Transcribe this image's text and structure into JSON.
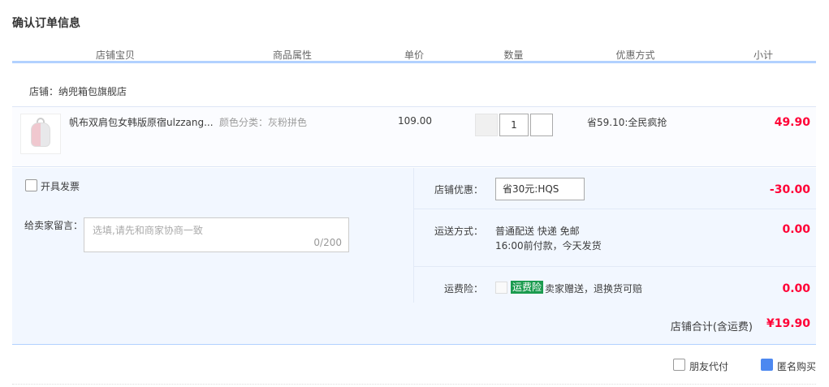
{
  "page": {
    "title": "确认订单信息"
  },
  "columns": [
    "店铺宝贝",
    "商品属性",
    "单价",
    "数量",
    "优惠方式",
    "小计"
  ],
  "shop": {
    "label": "店铺：纳兜箱包旗舰店"
  },
  "item": {
    "thumbnail": "backpack-image",
    "title": "帆布双肩包女韩版原宿ulzzang...",
    "attribute": "颜色分类：灰粉拼色",
    "price": "109.00",
    "quantity": "1",
    "promo": "省59.10:全民疯抢",
    "subtotal": "49.90"
  },
  "invoice": {
    "label": "开具发票",
    "checked": false
  },
  "message": {
    "label": "给卖家留言：",
    "placeholder": "选填,请先和商家协商一致",
    "counter": "0/200"
  },
  "shop_coupon": {
    "label": "店铺优惠：",
    "value": "省30元:HQS",
    "amount": "-30.00"
  },
  "shipping": {
    "label": "运送方式：",
    "line1": "普通配送 快递 免邮",
    "line2": "16:00前付款，今天发货",
    "amount": "0.00"
  },
  "insurance": {
    "label": "运费险：",
    "badge": "运费险",
    "text": "卖家赠送，退换货可赔",
    "amount": "0.00"
  },
  "total": {
    "label": "店铺合计(含运费)",
    "value": "¥19.90"
  },
  "options": {
    "friend_pay": {
      "label": "朋友代付",
      "checked": false
    },
    "anonymous": {
      "label": "匿名购买",
      "checked": true
    }
  },
  "colors": {
    "accent": "#ff0036",
    "header_rule": "#b2d1ff",
    "panel_bg": "#f2f7ff",
    "checkbox_blue": "#4d88f0",
    "badge_green": "#1b9b4f"
  }
}
